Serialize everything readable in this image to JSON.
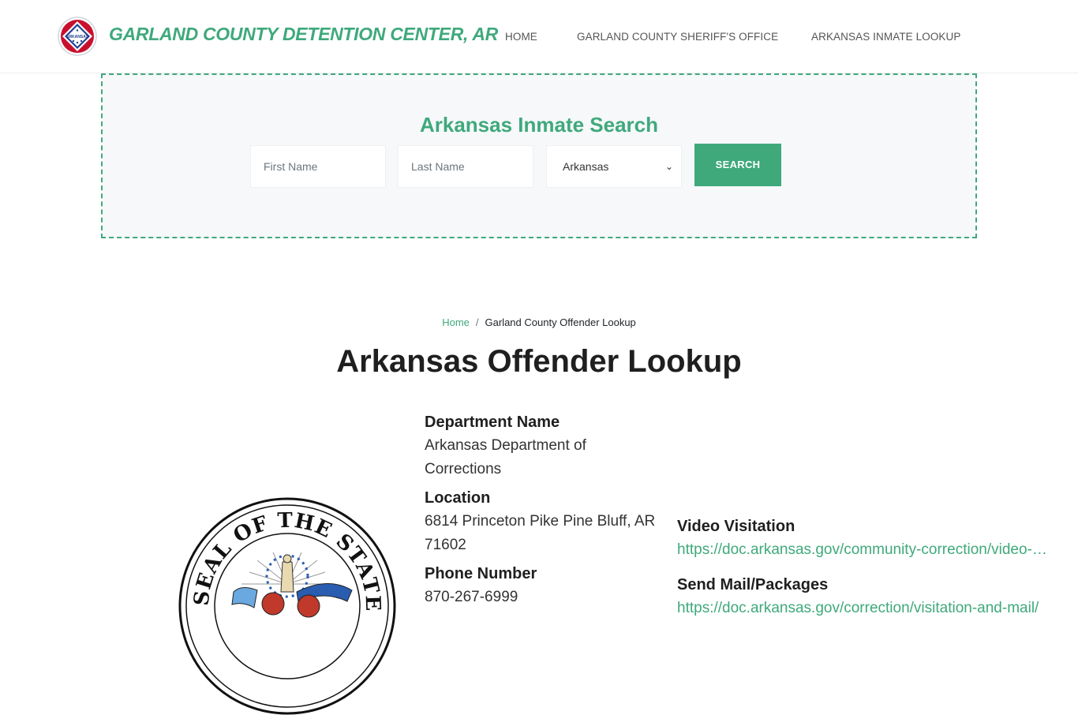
{
  "header": {
    "site_title": "GARLAND COUNTY DETENTION CENTER, AR",
    "logo_text": "ARKANSAS",
    "nav": [
      {
        "label": "HOME"
      },
      {
        "label": "GARLAND COUNTY SHERIFF'S OFFICE"
      },
      {
        "label": "ARKANSAS INMATE LOOKUP"
      }
    ]
  },
  "search": {
    "title": "Arkansas Inmate Search",
    "first_name_placeholder": "First Name",
    "last_name_placeholder": "Last Name",
    "state_selected": "Arkansas",
    "button_label": "SEARCH"
  },
  "breadcrumb": {
    "home": "Home",
    "separator": "/",
    "current": "Garland County Offender Lookup"
  },
  "page_title": "Arkansas Offender Lookup",
  "info": {
    "department_label": "Department Name",
    "department_value": "Arkansas Department of Corrections",
    "location_label": "Location",
    "location_value": "6814 Princeton Pike Pine Bluff, AR 71602",
    "phone_label": "Phone Number",
    "phone_value": "870-267-6999",
    "video_label": "Video Visitation",
    "video_value": "https://doc.arkansas.gov/community-correction/video-visitation/",
    "mail_label": "Send Mail/Packages",
    "mail_value": "https://doc.arkansas.gov/correction/visitation-and-mail/"
  },
  "seal": {
    "text": "SEAL OF THE STATE OF ARKANSAS"
  },
  "colors": {
    "accent": "#3fa97c",
    "search_bg": "#f6f8fa",
    "text_dark": "#1f1f1f"
  }
}
